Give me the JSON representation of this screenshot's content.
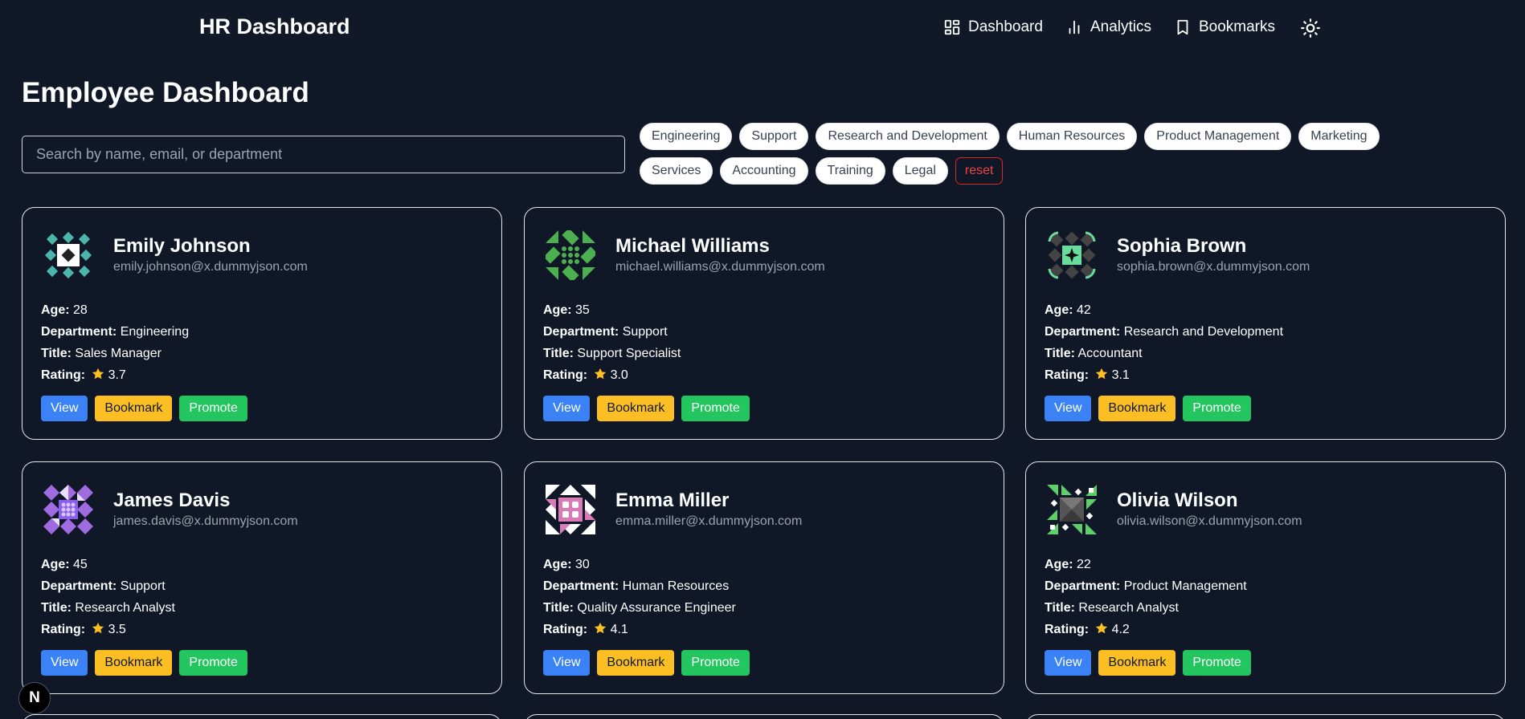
{
  "header": {
    "brand": "HR Dashboard",
    "nav": [
      {
        "label": "Dashboard",
        "icon": "grid-icon"
      },
      {
        "label": "Analytics",
        "icon": "bar-chart-icon"
      },
      {
        "label": "Bookmarks",
        "icon": "bookmark-icon"
      }
    ],
    "theme_icon": "sun-icon"
  },
  "main": {
    "title": "Employee Dashboard",
    "search_placeholder": "Search by name, email, or department",
    "filters": [
      "Engineering",
      "Support",
      "Research and Development",
      "Human Resources",
      "Product Management",
      "Marketing",
      "Services",
      "Accounting",
      "Training",
      "Legal"
    ],
    "reset_label": "reset"
  },
  "labels": {
    "age": "Age:",
    "department": "Department:",
    "title": "Title:",
    "rating": "Rating:",
    "view": "View",
    "bookmark": "Bookmark",
    "promote": "Promote"
  },
  "employees": [
    {
      "name": "Emily Johnson",
      "email": "emily.johnson@x.dummyjson.com",
      "age": "28",
      "department": "Engineering",
      "title": "Sales Manager",
      "rating": "3.7",
      "avatar_color": "#4db6ac"
    },
    {
      "name": "Michael Williams",
      "email": "michael.williams@x.dummyjson.com",
      "age": "35",
      "department": "Support",
      "title": "Support Specialist",
      "rating": "3.0",
      "avatar_color": "#4caf50"
    },
    {
      "name": "Sophia Brown",
      "email": "sophia.brown@x.dummyjson.com",
      "age": "42",
      "department": "Research and Development",
      "title": "Accountant",
      "rating": "3.1",
      "avatar_color": "#69db9c"
    },
    {
      "name": "James Davis",
      "email": "james.davis@x.dummyjson.com",
      "age": "45",
      "department": "Support",
      "title": "Research Analyst",
      "rating": "3.5",
      "avatar_color": "#9f6be0"
    },
    {
      "name": "Emma Miller",
      "email": "emma.miller@x.dummyjson.com",
      "age": "30",
      "department": "Human Resources",
      "title": "Quality Assurance Engineer",
      "rating": "4.1",
      "avatar_color": "#d97bb6"
    },
    {
      "name": "Olivia Wilson",
      "email": "olivia.wilson@x.dummyjson.com",
      "age": "22",
      "department": "Product Management",
      "title": "Research Analyst",
      "rating": "4.2",
      "avatar_color": "#5fcf6a"
    }
  ],
  "dev_badge": "N",
  "colors": {
    "background": "#101828",
    "view": "#3b82f6",
    "bookmark": "#fbbf24",
    "promote": "#22c55e",
    "reset": "#dc2626",
    "star": "#fbbf24"
  }
}
